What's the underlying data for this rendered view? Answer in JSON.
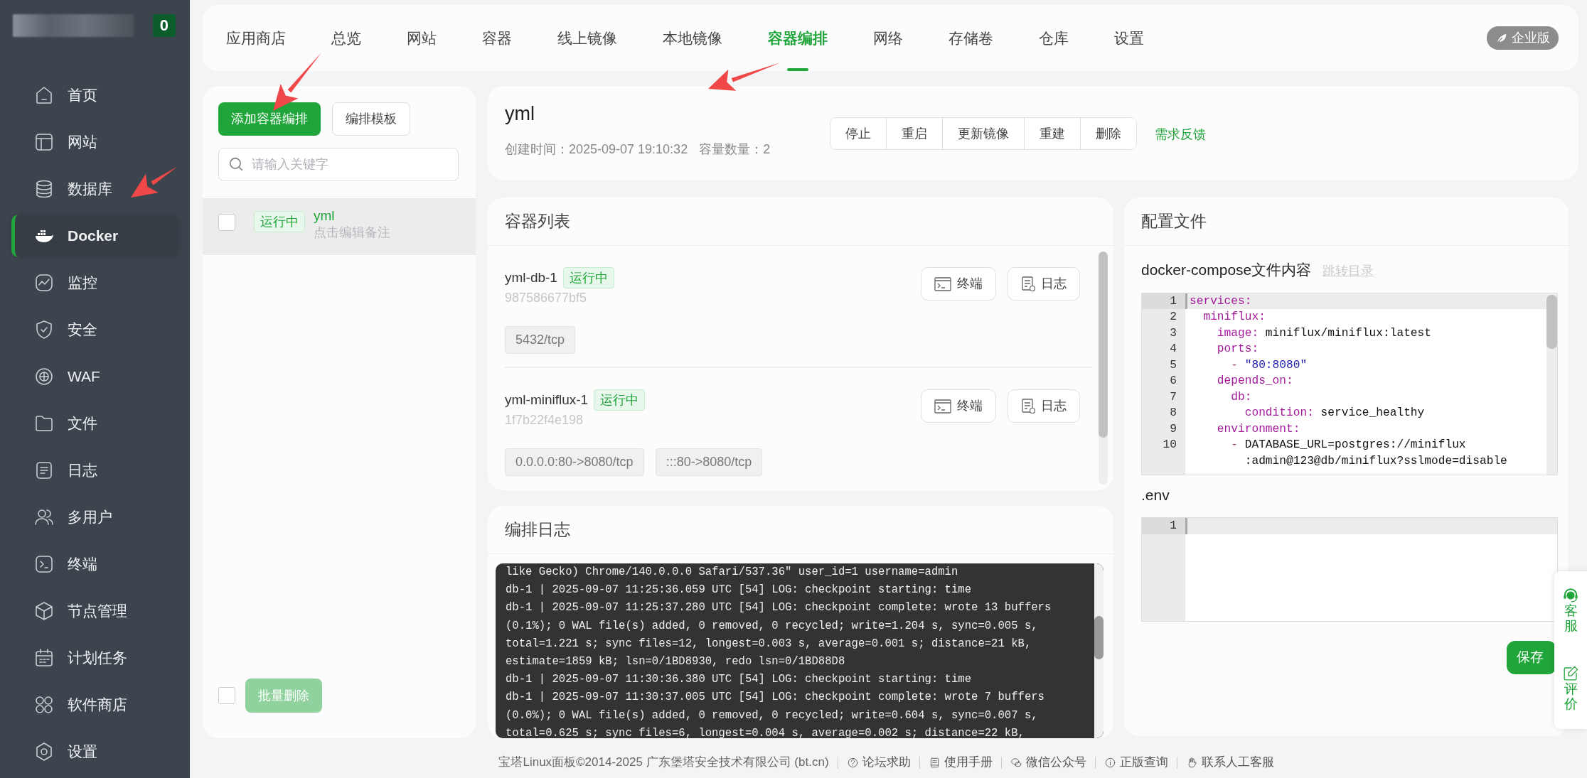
{
  "sidebar": {
    "badge": "0",
    "items": [
      {
        "label": "首页",
        "kind": "home",
        "selected": false
      },
      {
        "label": "网站",
        "kind": "site",
        "selected": false
      },
      {
        "label": "数据库",
        "kind": "database",
        "selected": false
      },
      {
        "label": "Docker",
        "kind": "docker",
        "selected": true
      },
      {
        "label": "监控",
        "kind": "monitor",
        "selected": false
      },
      {
        "label": "安全",
        "kind": "shield",
        "selected": false
      },
      {
        "label": "WAF",
        "kind": "globe",
        "selected": false
      },
      {
        "label": "文件",
        "kind": "folder",
        "selected": false
      },
      {
        "label": "日志",
        "kind": "log",
        "selected": false
      },
      {
        "label": "多用户",
        "kind": "users",
        "selected": false
      },
      {
        "label": "终端",
        "kind": "terminal",
        "selected": false
      },
      {
        "label": "节点管理",
        "kind": "cube",
        "selected": false
      },
      {
        "label": "计划任务",
        "kind": "calendar",
        "selected": false
      },
      {
        "label": "软件商店",
        "kind": "apps",
        "selected": false
      },
      {
        "label": "设置",
        "kind": "gear",
        "selected": false
      }
    ]
  },
  "top_tabs": [
    {
      "label": "应用商店",
      "selected": false
    },
    {
      "label": "总览",
      "selected": false
    },
    {
      "label": "网站",
      "selected": false
    },
    {
      "label": "容器",
      "selected": false
    },
    {
      "label": "线上镜像",
      "selected": false
    },
    {
      "label": "本地镜像",
      "selected": false
    },
    {
      "label": "容器编排",
      "selected": true
    },
    {
      "label": "网络",
      "selected": false
    },
    {
      "label": "存储卷",
      "selected": false
    },
    {
      "label": "仓库",
      "selected": false
    },
    {
      "label": "设置",
      "selected": false
    }
  ],
  "edition_badge": "企业版",
  "compose_panel": {
    "add_button": "添加容器编排",
    "template_button": "编排模板",
    "search": {
      "placeholder": "请输入关键字"
    },
    "items": [
      {
        "status": "运行中",
        "name": "yml",
        "note": "点击编辑备注",
        "selected": true,
        "checked": false
      }
    ],
    "batch_select": {
      "checked": false
    },
    "batch_delete": {
      "label": "批量删除",
      "disabled": true
    }
  },
  "header": {
    "title": "yml",
    "created": "创建时间：2025-09-07 19:10:32",
    "count": "容量数量：2",
    "actions": [
      "停止",
      "重启",
      "更新镜像",
      "重建",
      "删除"
    ],
    "feedback_link": "需求反馈"
  },
  "container_list": {
    "title": "容器列表",
    "containers": [
      {
        "name": "yml-db-1",
        "status": "运行中",
        "id": "987586677bf5",
        "ports": [
          "5432/tcp"
        ],
        "terminal_button": "终端",
        "log_button": "日志"
      },
      {
        "name": "yml-miniflux-1",
        "status": "运行中",
        "id": "1f7b22f4e198",
        "ports": [
          "0.0.0.0:80->8080/tcp",
          ":::80->8080/tcp"
        ],
        "terminal_button": "终端",
        "log_button": "日志"
      }
    ]
  },
  "compose_log": {
    "title": "编排日志",
    "lines": [
      "like Gecko) Chrome/140.0.0.0 Safari/537.36\" user_id=1 username=admin",
      "db-1 | 2025-09-07 11:25:36.059 UTC [54] LOG: checkpoint starting: time",
      "db-1 | 2025-09-07 11:25:37.280 UTC [54] LOG: checkpoint complete: wrote 13 buffers",
      "(0.1%); 0 WAL file(s) added, 0 removed, 0 recycled; write=1.204 s, sync=0.005 s,",
      "total=1.221 s; sync files=12, longest=0.003 s, average=0.001 s; distance=21 kB,",
      "estimate=1859 kB; lsn=0/1BD8930, redo lsn=0/1BD88D8",
      "db-1 | 2025-09-07 11:30:36.380 UTC [54] LOG: checkpoint starting: time",
      "db-1 | 2025-09-07 11:30:37.005 UTC [54] LOG: checkpoint complete: wrote 7 buffers",
      "(0.0%); 0 WAL file(s) added, 0 removed, 0 recycled; write=0.604 s, sync=0.007 s,",
      "total=0.625 s; sync files=6, longest=0.004 s, average=0.002 s; distance=22 kB,"
    ]
  },
  "config": {
    "title": "配置文件",
    "compose_label": "docker-compose文件内容",
    "jump_link": "跳转目录",
    "compose_lines": [
      {
        "number": "1",
        "active": true,
        "segments": [
          {
            "text": "services:",
            "kind": "key"
          }
        ]
      },
      {
        "number": "2",
        "active": false,
        "segments": [
          {
            "text": "  miniflux:",
            "kind": "key"
          }
        ]
      },
      {
        "number": "3",
        "active": false,
        "segments": [
          {
            "text": "    image:",
            "kind": "key"
          },
          {
            "text": " miniflux/miniflux:latest",
            "kind": "plain"
          }
        ]
      },
      {
        "number": "4",
        "active": false,
        "segments": [
          {
            "text": "    ports:",
            "kind": "key"
          }
        ]
      },
      {
        "number": "5",
        "active": false,
        "segments": [
          {
            "text": "      - ",
            "kind": "dash"
          },
          {
            "text": "\"80:8080\"",
            "kind": "string"
          }
        ]
      },
      {
        "number": "6",
        "active": false,
        "segments": [
          {
            "text": "    depends_on:",
            "kind": "key"
          }
        ]
      },
      {
        "number": "7",
        "active": false,
        "segments": [
          {
            "text": "      db:",
            "kind": "key"
          }
        ]
      },
      {
        "number": "8",
        "active": false,
        "segments": [
          {
            "text": "        condition:",
            "kind": "key"
          },
          {
            "text": " service_healthy",
            "kind": "plain"
          }
        ]
      },
      {
        "number": "9",
        "active": false,
        "segments": [
          {
            "text": "    environment:",
            "kind": "key"
          }
        ]
      },
      {
        "number": "10",
        "active": false,
        "segments": [
          {
            "text": "      - ",
            "kind": "dash"
          },
          {
            "text": "DATABASE_URL=postgres://miniflux",
            "kind": "plain"
          }
        ],
        "continuation": [
          {
            "text": ":admin@123@db/miniflux?sslmode=disable",
            "kind": "plain"
          }
        ]
      }
    ],
    "env_label": ".env",
    "env_lines": [
      {
        "number": "1",
        "active": true
      }
    ],
    "save_button": "保存"
  },
  "float_widget": [
    {
      "label": "客服",
      "kind": "headset"
    },
    {
      "label": "评价",
      "kind": "edit"
    }
  ],
  "footer": {
    "copyright": "宝塔Linux面板©2014-2025 广东堡塔安全技术有限公司 (bt.cn)",
    "links": [
      {
        "label": "论坛求助",
        "kind": "question"
      },
      {
        "label": "使用手册",
        "kind": "book"
      },
      {
        "label": "微信公众号",
        "kind": "wechat"
      },
      {
        "label": "正版查询",
        "kind": "info"
      },
      {
        "label": "联系人工客服",
        "kind": "hand"
      }
    ]
  }
}
